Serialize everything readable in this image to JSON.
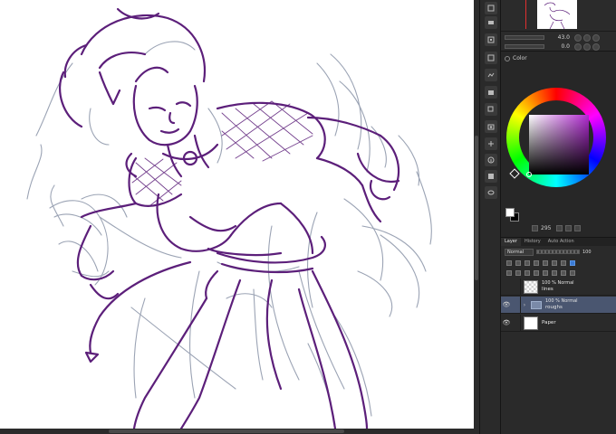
{
  "navigator": {
    "zoom_value": "43.0",
    "rotate_value": "0.0"
  },
  "color_panel": {
    "tab_label": "Color",
    "color_code": "295",
    "main_color": "#ffffff",
    "sub_color": "#000000",
    "hue_accent": "#b02ad0"
  },
  "layer_panel": {
    "tabs": [
      "Layer",
      "History",
      "Auto Action"
    ],
    "blend_mode": "Normal",
    "opacity": "100",
    "layers": [
      {
        "mode": "100 % Normal",
        "name": "lines",
        "kind": "raster",
        "visible": false,
        "selected": false
      },
      {
        "mode": "100 % Normal",
        "name": "roughs",
        "kind": "folder",
        "visible": true,
        "selected": true
      },
      {
        "mode": "",
        "name": "Paper",
        "kind": "paper",
        "visible": true,
        "selected": false
      }
    ]
  },
  "canvas": {
    "line_purple": "#5c1f7a",
    "line_blue": "#7d8aa0"
  }
}
